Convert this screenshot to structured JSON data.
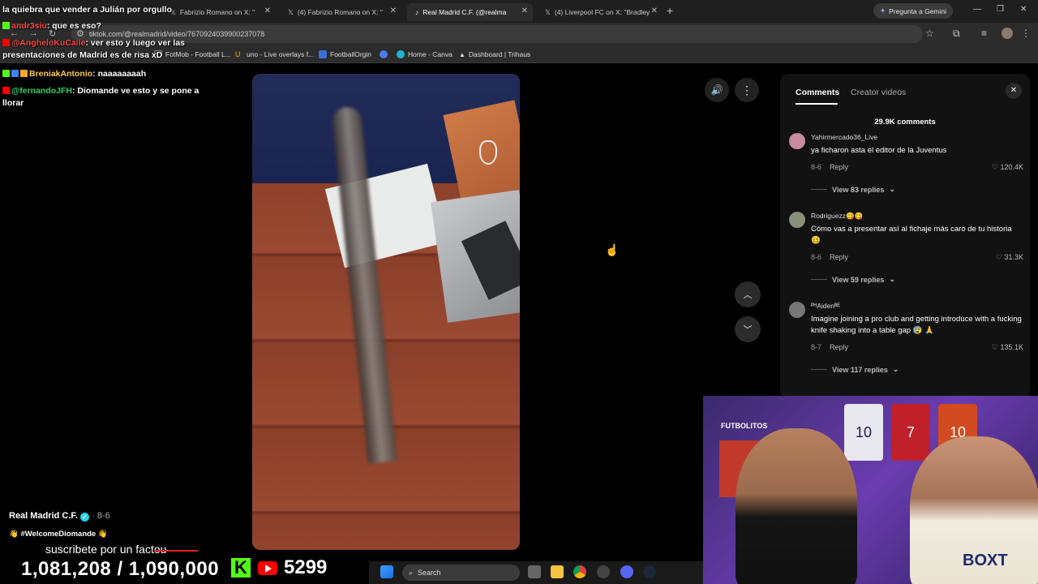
{
  "tabs": [
    {
      "label": "la quiebra que vender a Julián por orgullo",
      "active": false
    },
    {
      "label": "Fabrizio Romano on X: \"",
      "active": false
    },
    {
      "label": "(4) Fabrizio Romano on X: \"",
      "active": false
    },
    {
      "label": "Real Madrid C.F. (@realma",
      "active": true
    },
    {
      "label": "(4) Liverpool FC on X: \"Bradley",
      "active": false
    }
  ],
  "gemini_label": "Pregunta a Gemini",
  "url": "tiktok.com/@realmadrid/video/7670924039900237078",
  "bookmarks": [
    "FotMob - Football L...",
    "uno - Live overlays f...",
    "FootballOrgin",
    "Home - Canva",
    "Dashboard | Trihaus"
  ],
  "chat": [
    {
      "user": "andr3siu",
      "message": ": que es eso?",
      "color": "red"
    },
    {
      "user": "@AngheloKuCalle",
      "message": ": ver esto y luego ver las presentaciones de Madrid es de risa xD",
      "color": "red"
    },
    {
      "user": "BreniakAntonio",
      "message": ": naaaaaaaah",
      "color": "yellow"
    },
    {
      "user": "@fernandoJFH",
      "message": ": Diomande ve esto y se pone a llorar",
      "color": "green"
    }
  ],
  "video": {
    "account": "Real Madrid C.F.",
    "date": "8-6",
    "caption": "👋 #WelcomeDiomande 👋",
    "subtitle": "suscribete por un factou"
  },
  "comments_panel": {
    "tab_comments": "Comments",
    "tab_creator": "Creator videos",
    "count": "29.9K comments",
    "reply_label": "Reply",
    "items": [
      {
        "user": "Yahirmercado36_Live",
        "text": "ya ficharon asta el editor de la Juventus",
        "date": "8-6",
        "likes": "120.4K",
        "replies": "View 83 replies"
      },
      {
        "user": "Rodriguezz😋😋",
        "text": "Cómo vas a presentar así al fichaje más caro de tu historia 🥴",
        "date": "8-6",
        "likes": "31.3K",
        "replies": "View 59 replies"
      },
      {
        "user": "ᴾᴴAidenᴮᴱ",
        "text": "Imagine joining a pro club and getting introduce with a fucking knife shaking into a table gap 😰 🙏",
        "date": "8-7",
        "likes": "135.1K",
        "replies": "View 117 replies"
      }
    ]
  },
  "webcam": {
    "sign": "FUTBOLITOS",
    "jersey_numbers": [
      "10",
      "7",
      "10"
    ],
    "shirt_text": "BOXT"
  },
  "stream_stats": {
    "followers": "1,081,208",
    "goal": "/ 1,090,000",
    "youtube_count": "5299"
  },
  "taskbar": {
    "search_placeholder": "Search"
  },
  "colors": {
    "accent_kick": "#53fc18",
    "youtube_red": "#ff0000",
    "chat_red": "#ff4a4a",
    "chat_green": "#36d16a",
    "chat_yellow": "#ffc94a"
  }
}
